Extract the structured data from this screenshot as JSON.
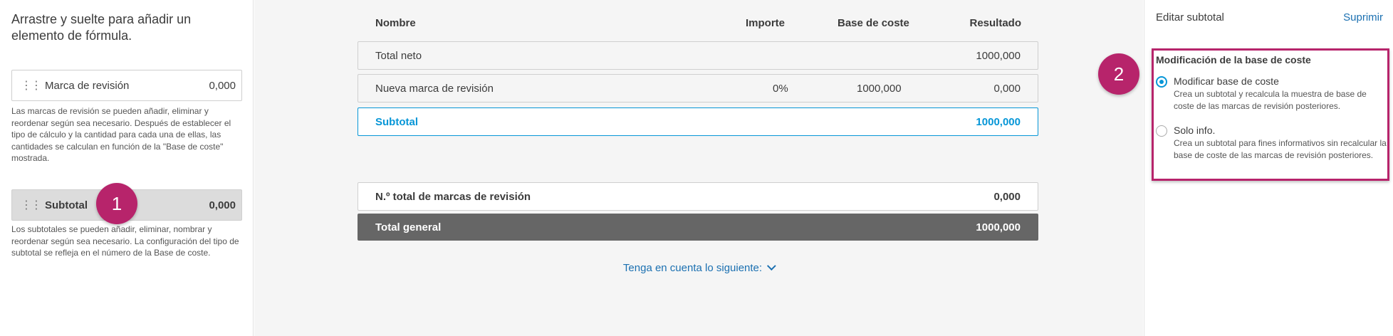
{
  "left_panel": {
    "title": "Arrastre y suelte para añadir un elemento de fórmula.",
    "markup_item": {
      "label": "Marca de revisión",
      "value": "0,000"
    },
    "markup_help": "Las marcas de revisión se pueden añadir, eliminar y reordenar según sea necesario. Después de establecer el tipo de cálculo y la cantidad para cada una de ellas, las cantidades se calculan en función de la \"Base de coste\" mostrada.",
    "subtotal_item": {
      "label": "Subtotal",
      "value": "0,000"
    },
    "subtotal_help": "Los subtotales se pueden añadir, eliminar, nombrar y reordenar según sea necesario. La configuración del tipo de subtotal se refleja en el número de la Base de coste."
  },
  "badges": {
    "one": "1",
    "two": "2"
  },
  "table": {
    "headers": {
      "name": "Nombre",
      "amount": "Importe",
      "cost_base": "Base de coste",
      "result": "Resultado"
    },
    "rows": [
      {
        "name": "Total neto",
        "amount": "",
        "cost_base": "",
        "result": "1000,000"
      },
      {
        "name": "Nueva marca de revisión",
        "amount": "0%",
        "cost_base": "1000,000",
        "result": "0,000"
      },
      {
        "name": "Subtotal",
        "amount": "",
        "cost_base": "",
        "result": "1000,000"
      }
    ],
    "total_markups": {
      "name": "N.º total de marcas de revisión",
      "result": "0,000"
    },
    "grand_total": {
      "name": "Total general",
      "result": "1000,000"
    },
    "note_link": "Tenga en cuenta lo siguiente:"
  },
  "right_panel": {
    "header": "Editar subtotal",
    "delete": "Suprimir",
    "section_title": "Modificación de la base de coste",
    "options": [
      {
        "label": "Modificar base de coste",
        "desc": "Crea un subtotal y recalcula la muestra de base de coste de las marcas de revisión posteriores.",
        "checked": true
      },
      {
        "label": "Solo info.",
        "desc": "Crea un subtotal para fines informativos sin recalcular la base de coste de las marcas de revisión posteriores.",
        "checked": false
      }
    ]
  },
  "colors": {
    "accent": "#0696d7",
    "highlight": "#b7246b",
    "link": "#1b70b1",
    "grand_total_bg": "#666666"
  },
  "icons": {
    "grip": "drag-handle-icon",
    "chevron": "chevron-down-icon"
  }
}
